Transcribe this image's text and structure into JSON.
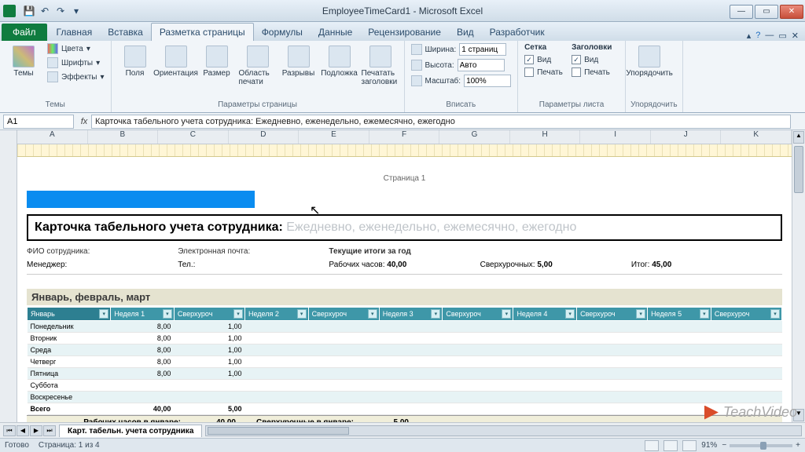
{
  "window": {
    "title": "EmployeeTimeCard1 - Microsoft Excel"
  },
  "tabs": {
    "file": "Файл",
    "items": [
      "Главная",
      "Вставка",
      "Разметка страницы",
      "Формулы",
      "Данные",
      "Рецензирование",
      "Вид",
      "Разработчик"
    ],
    "active": 2
  },
  "ribbon": {
    "themes_group": "Темы",
    "themes": "Темы",
    "colors": "Цвета",
    "fonts": "Шрифты",
    "effects": "Эффекты",
    "page_setup_group": "Параметры страницы",
    "margins": "Поля",
    "orientation": "Ориентация",
    "size": "Размер",
    "print_area": "Область печати",
    "breaks": "Разрывы",
    "background": "Подложка",
    "print_titles": "Печатать заголовки",
    "fit_group": "Вписать",
    "width": "Ширина:",
    "width_val": "1 страниц",
    "height": "Высота:",
    "height_val": "Авто",
    "scale": "Масштаб:",
    "scale_val": "100%",
    "sheet_group": "Параметры листа",
    "gridlines": "Сетка",
    "headings": "Заголовки",
    "view": "Вид",
    "print": "Печать",
    "arrange_group": "Упорядочить",
    "arrange": "Упорядочить"
  },
  "formula_bar": {
    "cell": "A1",
    "value": "Карточка табельного учета сотрудника: Ежедневно, еженедельно, ежемесячно, ежегодно"
  },
  "columns": [
    "A",
    "B",
    "C",
    "D",
    "E",
    "F",
    "G",
    "H",
    "I",
    "J",
    "K"
  ],
  "doc": {
    "page_label": "Страница 1",
    "title_bold": "Карточка табельного учета сотрудника:",
    "title_gray": " Ежедневно, еженедельно, ежемесячно, ежегодно",
    "fio": "ФИО сотрудника:",
    "email": "Электронная почта:",
    "year_totals": "Текущие итоги за год",
    "manager": "Менеджер:",
    "tel": "Тел.:",
    "work_hours": "Рабочих часов:",
    "work_hours_v": "40,00",
    "overtime": "Сверхурочных:",
    "overtime_v": "5,00",
    "total": "Итог:",
    "total_v": "45,00",
    "section": "Январь, февраль, март",
    "headers": [
      "Январь",
      "Неделя 1",
      "Сверхуроч",
      "Неделя 2",
      "Сверхуроч",
      "Неделя 3",
      "Сверхуроч",
      "Неделя 4",
      "Сверхуроч",
      "Неделя 5",
      "Сверхуроч"
    ],
    "rows": [
      {
        "d": "Понедельник",
        "w1": "8,00",
        "o1": "1,00"
      },
      {
        "d": "Вторник",
        "w1": "8,00",
        "o1": "1,00"
      },
      {
        "d": "Среда",
        "w1": "8,00",
        "o1": "1,00"
      },
      {
        "d": "Четверг",
        "w1": "8,00",
        "o1": "1,00"
      },
      {
        "d": "Пятница",
        "w1": "8,00",
        "o1": "1,00"
      },
      {
        "d": "Суббота",
        "w1": "",
        "o1": ""
      },
      {
        "d": "Воскресенье",
        "w1": "",
        "o1": ""
      },
      {
        "d": "Всего",
        "w1": "40,00",
        "o1": "5,00"
      }
    ],
    "sum_work_lbl": "Рабочих часов в январе:",
    "sum_work_v": "40,00",
    "sum_ot_lbl": "Сверхурочные в январе:",
    "sum_ot_v": "5,00"
  },
  "sheet_tab": "Карт. табельн. учета сотрудника",
  "status": {
    "ready": "Готово",
    "page": "Страница: 1 из 4",
    "zoom": "91%"
  },
  "watermark": "TeachVideo"
}
